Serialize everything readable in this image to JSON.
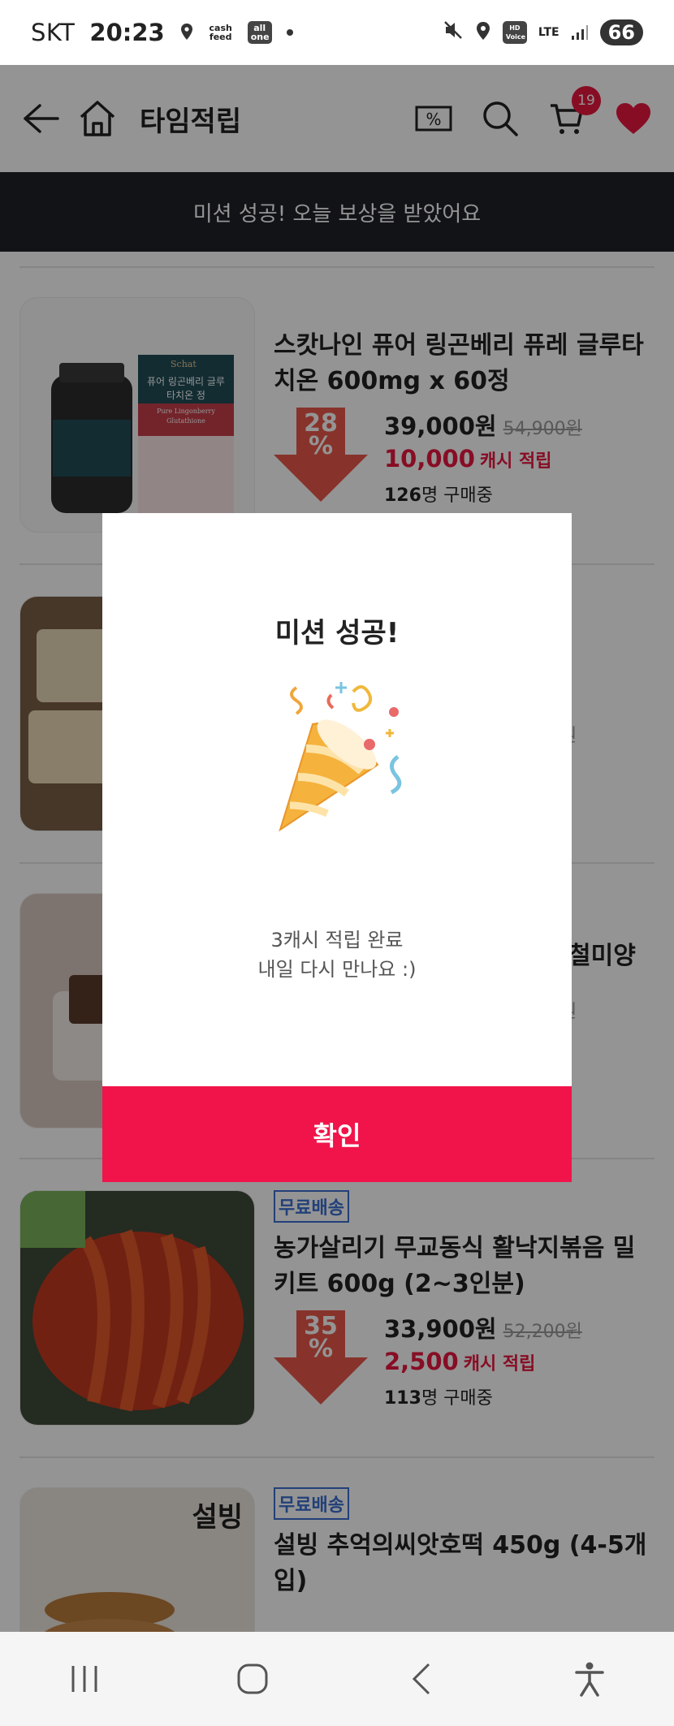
{
  "status_bar": {
    "carrier": "SKT",
    "time": "20:23",
    "cashfeed": "cash feed",
    "allone": "all one",
    "network": "LTE",
    "hd": "HD Voice",
    "battery": "66"
  },
  "header": {
    "title": "타임적립",
    "cart_count": "19"
  },
  "banner": {
    "text": "미션 성공! 오늘 보상을 받았어요"
  },
  "products": [
    {
      "name": "스캇나인 퓨어 링곤베리 퓨레 글루타치온 600mg x 60정",
      "discount": "28",
      "discount_unit": "%",
      "price": "39,000원",
      "original_price": "54,900원",
      "cash": "10,000",
      "cash_label": "캐시 적립",
      "buyers": "126",
      "buyers_label": "명 구매중",
      "shipping": ""
    },
    {
      "name": "",
      "discount": "",
      "discount_unit": "",
      "price": "",
      "original_price": "",
      "cash": "",
      "cash_label": "",
      "buyers": "",
      "buyers_label": "",
      "shipping": ""
    },
    {
      "name": "",
      "discount": "",
      "discount_unit": "",
      "price": "",
      "original_price": "",
      "cash": "",
      "cash_label": "",
      "buyers": "",
      "buyers_label": "",
      "shipping": ""
    },
    {
      "name": "농가살리기 무교동식 활낙지볶음 밀키트 600g (2~3인분)",
      "discount": "35",
      "discount_unit": "%",
      "price": "33,900원",
      "original_price": "52,200원",
      "cash": "2,500",
      "cash_label": "캐시 적립",
      "buyers": "113",
      "buyers_label": "명 구매중",
      "shipping": "무료배송"
    },
    {
      "name": "설빙 추억의씨앗호떡 450g (4-5개입)",
      "discount": "",
      "discount_unit": "",
      "price": "",
      "original_price": "",
      "cash": "",
      "cash_label": "",
      "buyers": "",
      "buyers_label": "",
      "shipping": "무료배송"
    }
  ],
  "product1_box": {
    "brand": "Schat",
    "label_ko": "퓨어 링곤베리 글루타치온 정",
    "label_en": "Pure Lingonberry Glutathione"
  },
  "product5_logo": "설빙",
  "partial_texts": {
    "row2_orig": "원",
    "row3_title": "철미양",
    "row3_orig": "원"
  },
  "modal": {
    "title": "미션 성공!",
    "message_line1": "3캐시 적립 완료",
    "message_line2": "내일 다시 만나요 :)",
    "confirm": "확인"
  },
  "colors": {
    "accent": "#f0144a",
    "discount_arrow": "#e8594a",
    "banner_bg": "#1f2227",
    "free_shipping": "#3b6fd1"
  }
}
